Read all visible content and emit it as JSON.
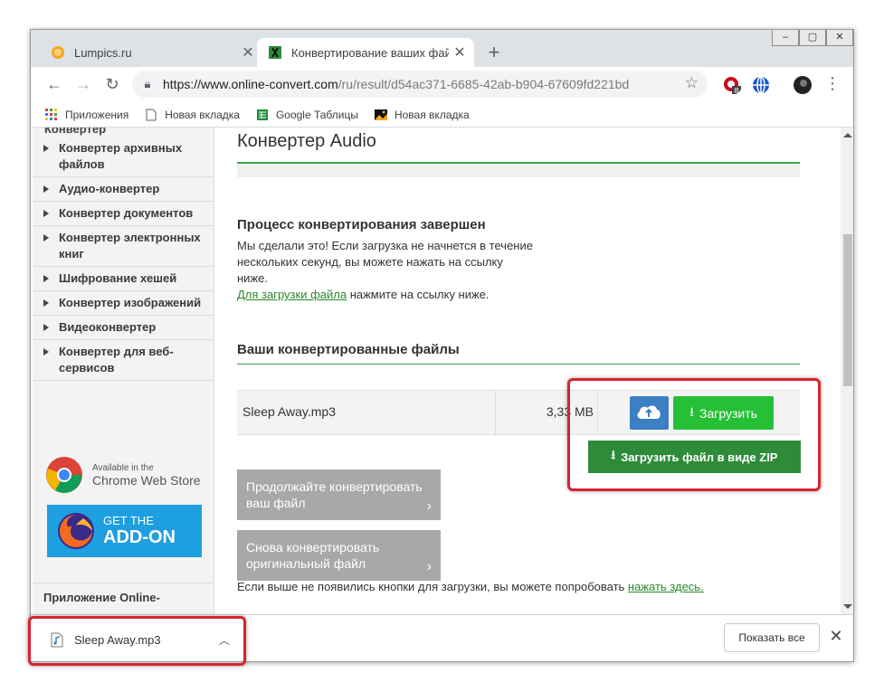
{
  "tabs": [
    {
      "title": "Lumpics.ru",
      "active": false
    },
    {
      "title": "Конвертирование ваших файлов",
      "active": true
    }
  ],
  "window_controls": [
    "minimize",
    "restore",
    "close"
  ],
  "omnibox": {
    "url_host": "https://www.online-convert.com",
    "url_path": "/ru/result/d54ac371-6685-42ab-b904-67609fd221bd"
  },
  "extension_badge": "8",
  "bookmarks": [
    {
      "label": "Приложения",
      "icon": "apps-grid-icon"
    },
    {
      "label": "Новая вкладка",
      "icon": "page-icon"
    },
    {
      "label": "Google Таблицы",
      "icon": "sheets-icon"
    },
    {
      "label": "Новая вкладка",
      "icon": "image-icon"
    }
  ],
  "sidebar": {
    "cut_header": "Конвертер",
    "items": [
      "Конвертер архивных файлов",
      "Аудио-конвертер",
      "Конвертер документов",
      "Конвертер электронных книг",
      "Шифрование хешей",
      "Конвертер изображений",
      "Видеоконвертер",
      "Конвертер для веб-сервисов"
    ],
    "chrome_store": {
      "line1": "Available in the",
      "line2": "Chrome Web Store"
    },
    "addon": {
      "line1": "GET THE",
      "line2": "ADD-ON"
    },
    "app_section": "Приложение Online-"
  },
  "main": {
    "title": "Конвертер Audio",
    "status_heading": "Процесс конвертирования завершен",
    "status_text": "Мы сделали это! Если загрузка не начнется в течение нескольких секунд, вы можете нажать на ссылку ниже.",
    "status_link": "Для загрузки файла",
    "status_link_suffix": " нажмите на ссылку ниже.",
    "files_heading": "Ваши конвертированные файлы",
    "file": {
      "name": "Sleep Away.mp3",
      "size": "3,33 MB"
    },
    "download_label": "Загрузить",
    "zip_label": "Загрузить файл в виде ZIP",
    "continue_label": "Продолжайте конвертировать ваш файл",
    "reconvert_label": "Снова конвертировать оригинальный файл",
    "footnote_text": "Если выше не появились кнопки для загрузки, вы можете попробовать ",
    "footnote_link": "нажать здесь."
  },
  "download_shelf": {
    "file_name": "Sleep Away.mp3",
    "show_all": "Показать все"
  },
  "colors": {
    "green_primary": "#25c036",
    "green_dark": "#2e8b3a",
    "blue_cloud": "#3d7fc3",
    "highlight_red": "#d9232d"
  }
}
